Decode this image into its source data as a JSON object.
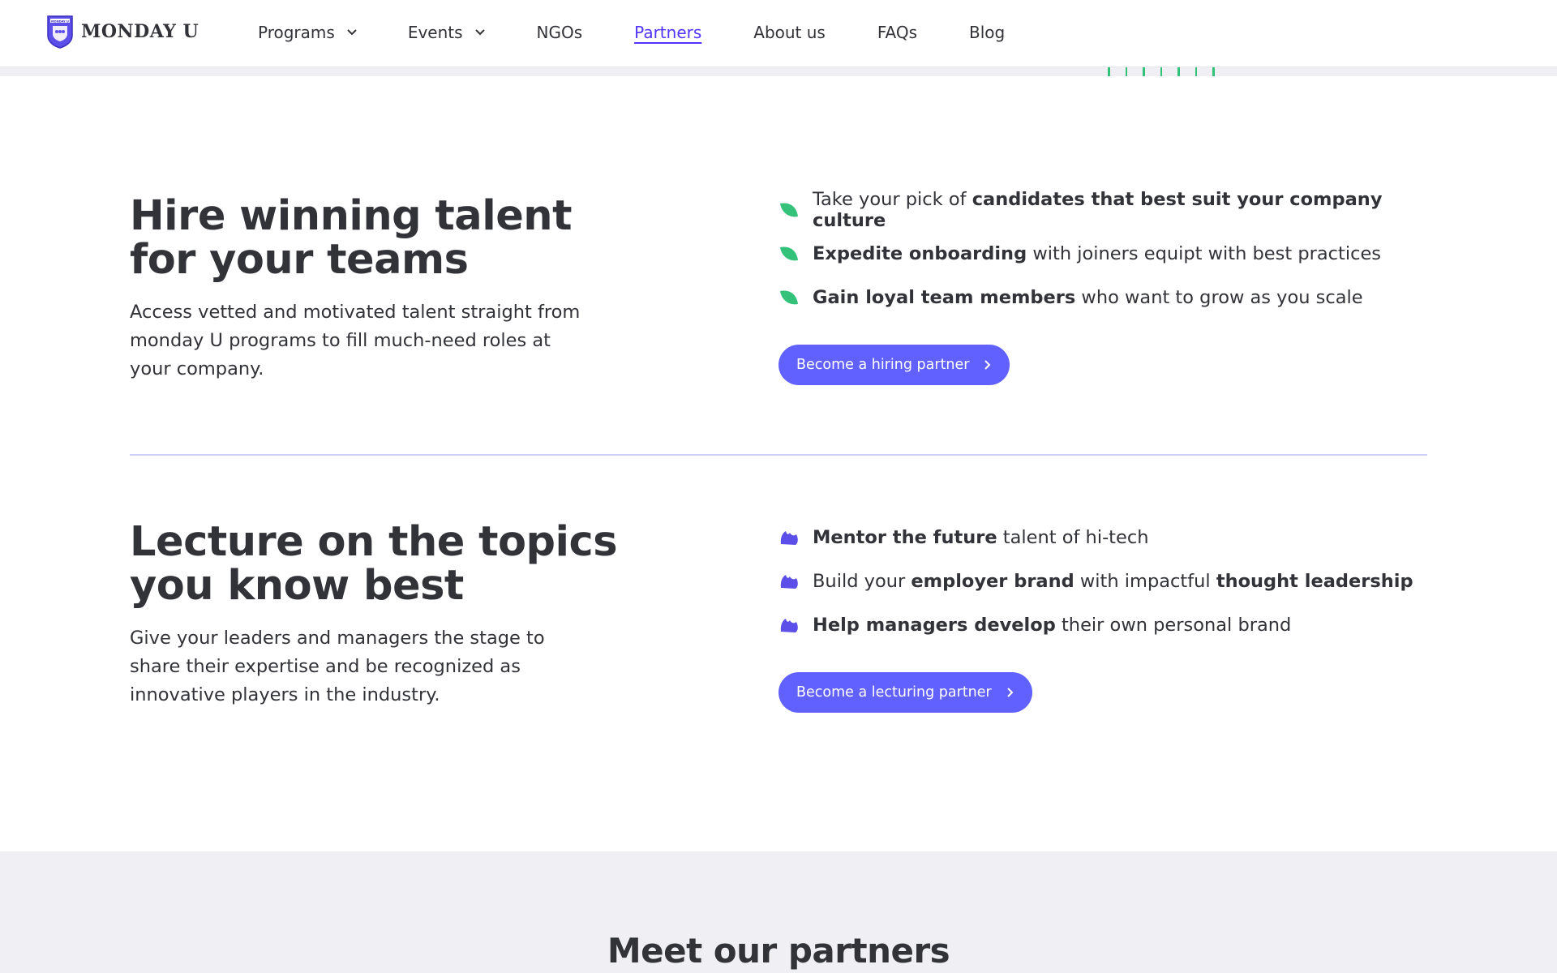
{
  "header": {
    "logo_text": "MONDAY U",
    "logo_crest_text": "MONDAY U",
    "nav": [
      {
        "label": "Programs",
        "dropdown": true
      },
      {
        "label": "Events",
        "dropdown": true
      },
      {
        "label": "NGOs",
        "dropdown": false
      },
      {
        "label": "Partners",
        "dropdown": false,
        "active": true
      },
      {
        "label": "About us",
        "dropdown": false
      },
      {
        "label": "FAQs",
        "dropdown": false
      },
      {
        "label": "Blog",
        "dropdown": false
      }
    ]
  },
  "hiring": {
    "headline_line1": "Hire winning talent",
    "headline_line2": "for your teams",
    "lede": "Access vetted and motivated talent straight from monday U programs to fill much-need roles at your company.",
    "bullet_icon": "green-leaf-icon",
    "bullets": [
      {
        "pre": "Take your pick of ",
        "bold": "candidates that best suit your company culture",
        "post": ""
      },
      {
        "pre": "",
        "bold": "Expedite onboarding",
        "post": " with joiners equipt with best practices"
      },
      {
        "pre": "",
        "bold": "Gain loyal team members",
        "post": " who want to grow as you scale"
      }
    ],
    "cta_label": "Become a hiring partner"
  },
  "lecturing": {
    "headline_line1": "Lecture on the topics",
    "headline_line2": "you know best",
    "lede": "Give your leaders and managers the stage to share their expertise and be recognized as innovative players in the industry.",
    "bullet_icon": "purple-bloom-icon",
    "bullets": [
      {
        "pre": "",
        "bold": "Mentor the future",
        "mid": " talent of hi-tech",
        "bold2": "",
        "post": ""
      },
      {
        "pre": "Build your ",
        "bold": "employer brand",
        "mid": " with impactful ",
        "bold2": "thought leadership",
        "post": ""
      },
      {
        "pre": "",
        "bold": "Help managers develop",
        "mid": " their own personal brand",
        "bold2": "",
        "post": ""
      }
    ],
    "cta_label": "Become a lecturing partner"
  },
  "partners": {
    "title": "Meet our partners"
  },
  "colors": {
    "accent": "#6161ff",
    "nav_active": "#5034ff",
    "leaf_green": "#34c27a",
    "bloom_purple": "#5c4ee8",
    "divider": "#cfd0f7",
    "band": "#f0f0f4"
  }
}
